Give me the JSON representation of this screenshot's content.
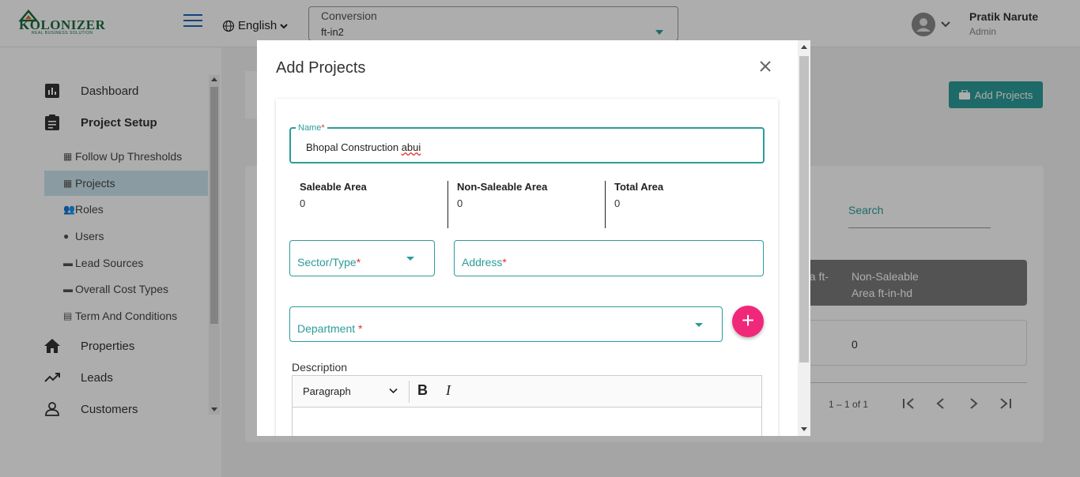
{
  "header": {
    "logo_text": "KOLONIZER",
    "logo_tagline": "REAL BUSINESS SOLUTION",
    "language": "English",
    "conversion_label": "Conversion",
    "conversion_value": "ft-in2",
    "user_name": "Pratik Narute",
    "user_role": "Admin"
  },
  "sidebar": {
    "dashboard": "Dashboard",
    "project_setup": "Project Setup",
    "sub_items": [
      {
        "label": "Follow Up Thresholds",
        "icon": "building-icon"
      },
      {
        "label": "Projects",
        "icon": "building-icon"
      },
      {
        "label": "Roles",
        "icon": "users-icon"
      },
      {
        "label": "Users",
        "icon": "user-icon"
      },
      {
        "label": "Lead Sources",
        "icon": "money-icon"
      },
      {
        "label": "Overall Cost Types",
        "icon": "money-icon"
      },
      {
        "label": "Term And Conditions",
        "icon": "document-icon"
      }
    ],
    "properties": "Properties",
    "leads": "Leads",
    "customers": "Customers"
  },
  "background": {
    "add_projects_label": "Add Projects",
    "search_label": "Search",
    "col_partial": "ea ft-",
    "col_non_saleable_line1": "Non-Saleable",
    "col_non_saleable_line2": "Area ft-in-hd",
    "row_value": "0",
    "pager_range": "1 – 1 of 1"
  },
  "modal": {
    "title": "Add Projects",
    "name_label": "Name",
    "name_required": "*",
    "name_value_prefix": "Bhopal Construction ",
    "name_value_misspelled": "abui",
    "saleable_title": "Saleable Area",
    "saleable_value": "0",
    "non_saleable_title": "Non-Saleable Area",
    "non_saleable_value": "0",
    "total_title": "Total Area",
    "total_value": "0",
    "sector_placeholder": "Sector/Type",
    "address_placeholder": "Address",
    "department_placeholder": "Department ",
    "required_mark": "*",
    "fab_label": "+",
    "description_label": "Description",
    "editor_block_style": "Paragraph",
    "bold_label": "B",
    "italic_label": "I"
  },
  "colors": {
    "accent": "#2b9c9a",
    "fab": "#f0287a",
    "required": "#e23030"
  }
}
